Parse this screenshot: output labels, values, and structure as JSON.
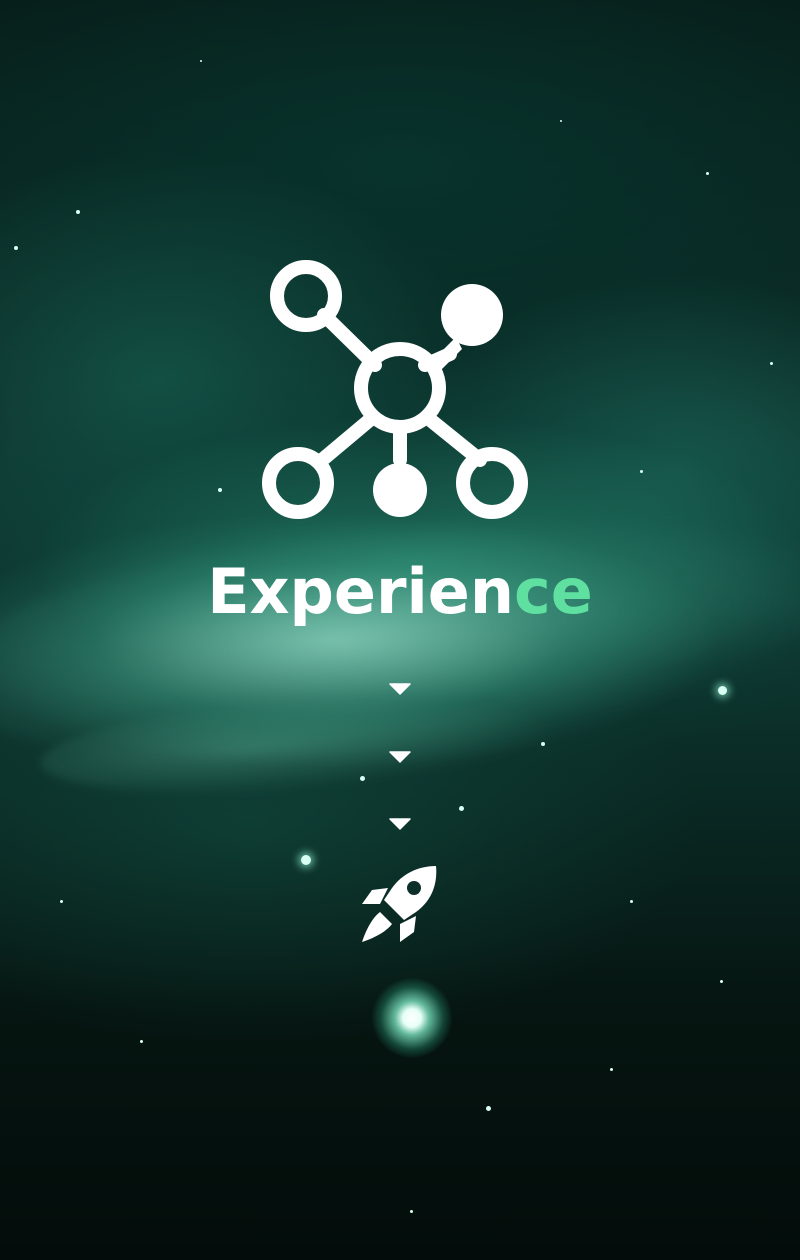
{
  "brand": {
    "title_main": "Experien",
    "title_accent": "ce",
    "accent_color": "#5fe0a0"
  },
  "icons": {
    "logo": "network-nodes-icon",
    "scroll_hint": "chevron-down-icon",
    "launch": "rocket-icon"
  },
  "colors": {
    "primary_text": "#ffffff",
    "background": "#0b2c27"
  }
}
